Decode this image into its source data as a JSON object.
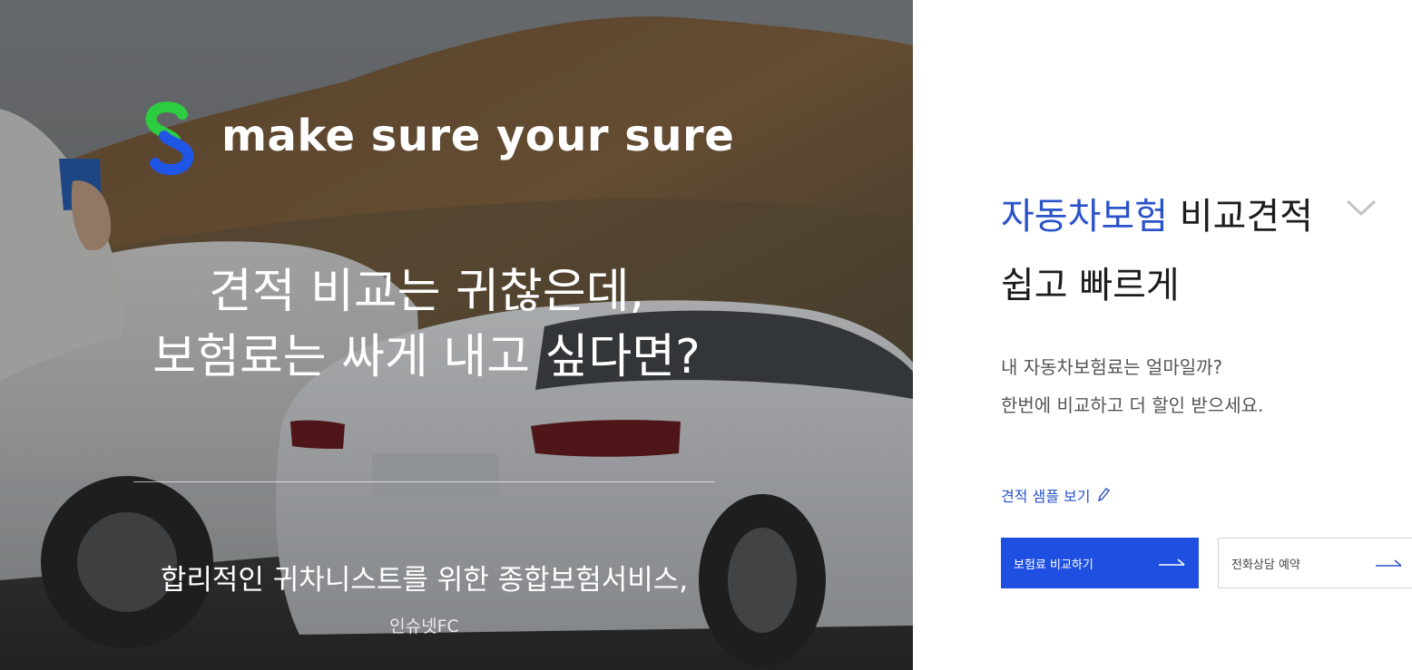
{
  "hero": {
    "logo_icon": "s-shield-logo-icon",
    "tagline": "make sure your sure",
    "headline_line1": "견적 비교는 귀찮은데,",
    "headline_line2": "보험료는 싸게 내고 싶다면?",
    "service_line": "합리적인 귀차니스트를 위한 종합보험서비스,",
    "company": "인슈넷FC"
  },
  "panel": {
    "title_accent": "자동차보험",
    "title_rest": " 비교견적",
    "dropdown_icon": "chevron-down-icon",
    "subtitle": "쉽고 빠르게",
    "desc_line1": "내 자동차보험료는 얼마일까?",
    "desc_line2": "한번에 비교하고 더 할인 받으세요.",
    "sample_link": "견적 샘플 보기",
    "sample_icon": "pencil-icon",
    "primary_button": "보험료 비교하기",
    "secondary_button": "전화상담 예약",
    "arrow_icon": "arrow-right-icon"
  },
  "colors": {
    "accent": "#2a52c9",
    "button_primary": "#1f4fe0",
    "logo_green": "#2ecc40",
    "logo_blue": "#2056e6"
  }
}
